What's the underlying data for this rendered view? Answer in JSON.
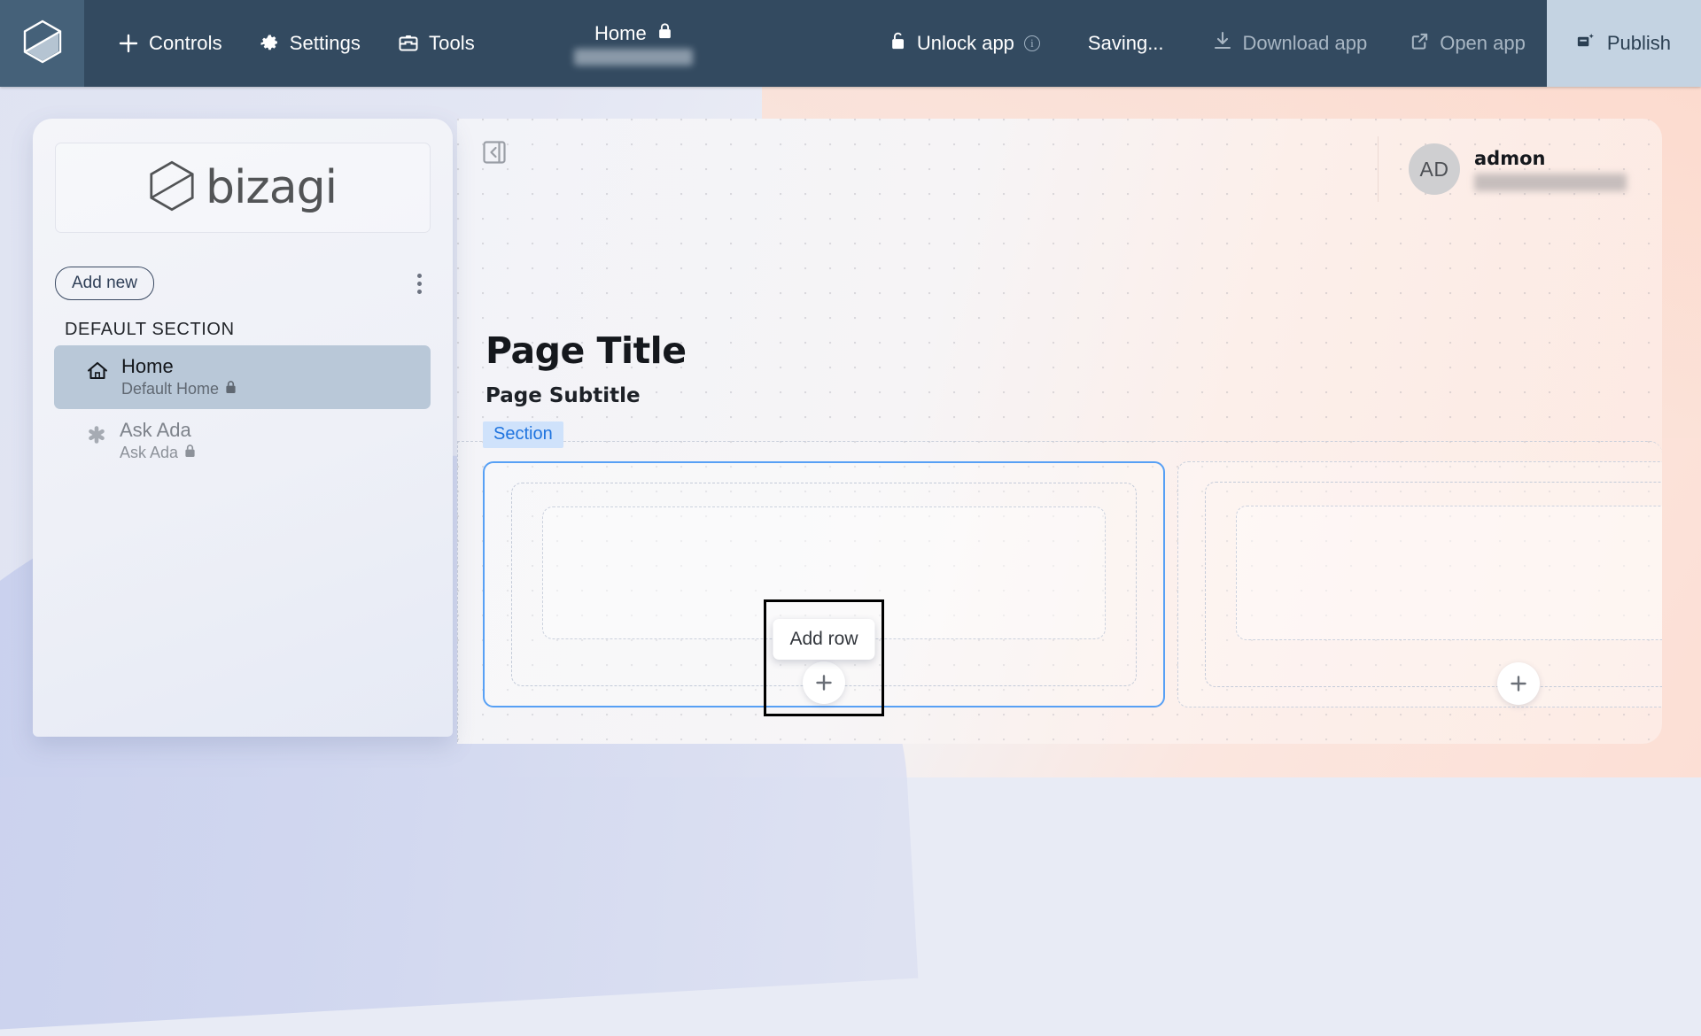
{
  "topbar": {
    "logo_icon": "bizagi-hexagon-icon",
    "menu": [
      {
        "label": "Controls",
        "icon": "plus-icon"
      },
      {
        "label": "Settings",
        "icon": "gear-icon"
      },
      {
        "label": "Tools",
        "icon": "toolbox-icon"
      }
    ],
    "page_chip": {
      "label": "Home",
      "icon": "lock-icon",
      "subtitle_redacted": true
    },
    "unlock": {
      "label": "Unlock app",
      "icon": "unlock-icon",
      "info_icon": "info-icon",
      "info_char": "i"
    },
    "status": "Saving...",
    "download": {
      "label": "Download app",
      "icon": "download-icon",
      "disabled": true
    },
    "open": {
      "label": "Open app",
      "icon": "external-link-icon",
      "disabled": true
    },
    "publish": {
      "label": "Publish",
      "icon": "publish-icon",
      "bg": "#c4d3e2",
      "fg": "#2b3f52"
    }
  },
  "sidebar": {
    "logo_text": "bizagi",
    "logo_icon": "bizagi-hexagon-icon",
    "add_new_label": "Add new",
    "kebab_icon": "more-vertical-icon",
    "section_header": "DEFAULT SECTION",
    "items": [
      {
        "title": "Home",
        "subtitle": "Default Home",
        "icon": "home-icon",
        "lock_icon": "lock-icon",
        "active": true
      },
      {
        "title": "Ask Ada",
        "subtitle": "Ask Ada",
        "icon": "asterisk-icon",
        "lock_icon": "lock-icon",
        "active": false
      }
    ]
  },
  "canvas": {
    "collapse_icon": "collapse-panel-icon",
    "user": {
      "initials": "AD",
      "name": "admon",
      "email_redacted": true
    },
    "page_title": "Page Title",
    "page_subtitle": "Page Subtitle",
    "section_tag": "Section",
    "add_row_tooltip": "Add row",
    "plus_icon": "plus-icon",
    "accent_blue": "#57a0f5",
    "tag_bg": "#cfe2fb",
    "tag_fg": "#1f74df"
  }
}
